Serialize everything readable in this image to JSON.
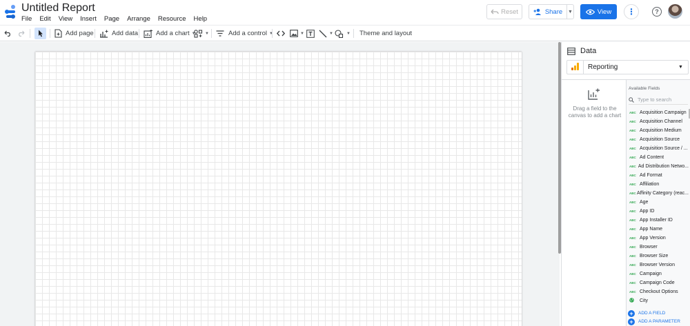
{
  "header": {
    "title": "Untitled Report",
    "menu": [
      "File",
      "Edit",
      "View",
      "Insert",
      "Page",
      "Arrange",
      "Resource",
      "Help"
    ],
    "reset_label": "Reset",
    "share_label": "Share",
    "view_label": "View"
  },
  "toolbar": {
    "add_page": "Add page",
    "add_data": "Add data",
    "add_chart": "Add a chart",
    "add_control": "Add a control",
    "theme_layout": "Theme and layout"
  },
  "panel": {
    "title": "Data",
    "data_source": "Reporting",
    "drop_hint": "Drag a field to the canvas to add a chart",
    "available_fields_label": "Available Fields",
    "search_placeholder": "Type to search",
    "field_type_tag": "ABC",
    "fields": [
      "Acquisition Campaign",
      "Acquisition Channel",
      "Acquisition Medium",
      "Acquisition Source",
      "Acquisition Source / ...",
      "Ad Content",
      "Ad Distribution Netwo...",
      "Ad Format",
      "Affiliation",
      "Affinity Category (reac...",
      "Age",
      "App ID",
      "App Installer ID",
      "App Name",
      "App Version",
      "Browser",
      "Browser Size",
      "Browser Version",
      "Campaign",
      "Campaign Code",
      "Checkout Options",
      "City"
    ],
    "add_field": "ADD A FIELD",
    "add_parameter": "ADD A PARAMETER"
  },
  "colors": {
    "accent": "#1a73e8",
    "ga_orange": "#f9ab00",
    "ga_dark_orange": "#e37400",
    "type_green": "#34a853"
  }
}
